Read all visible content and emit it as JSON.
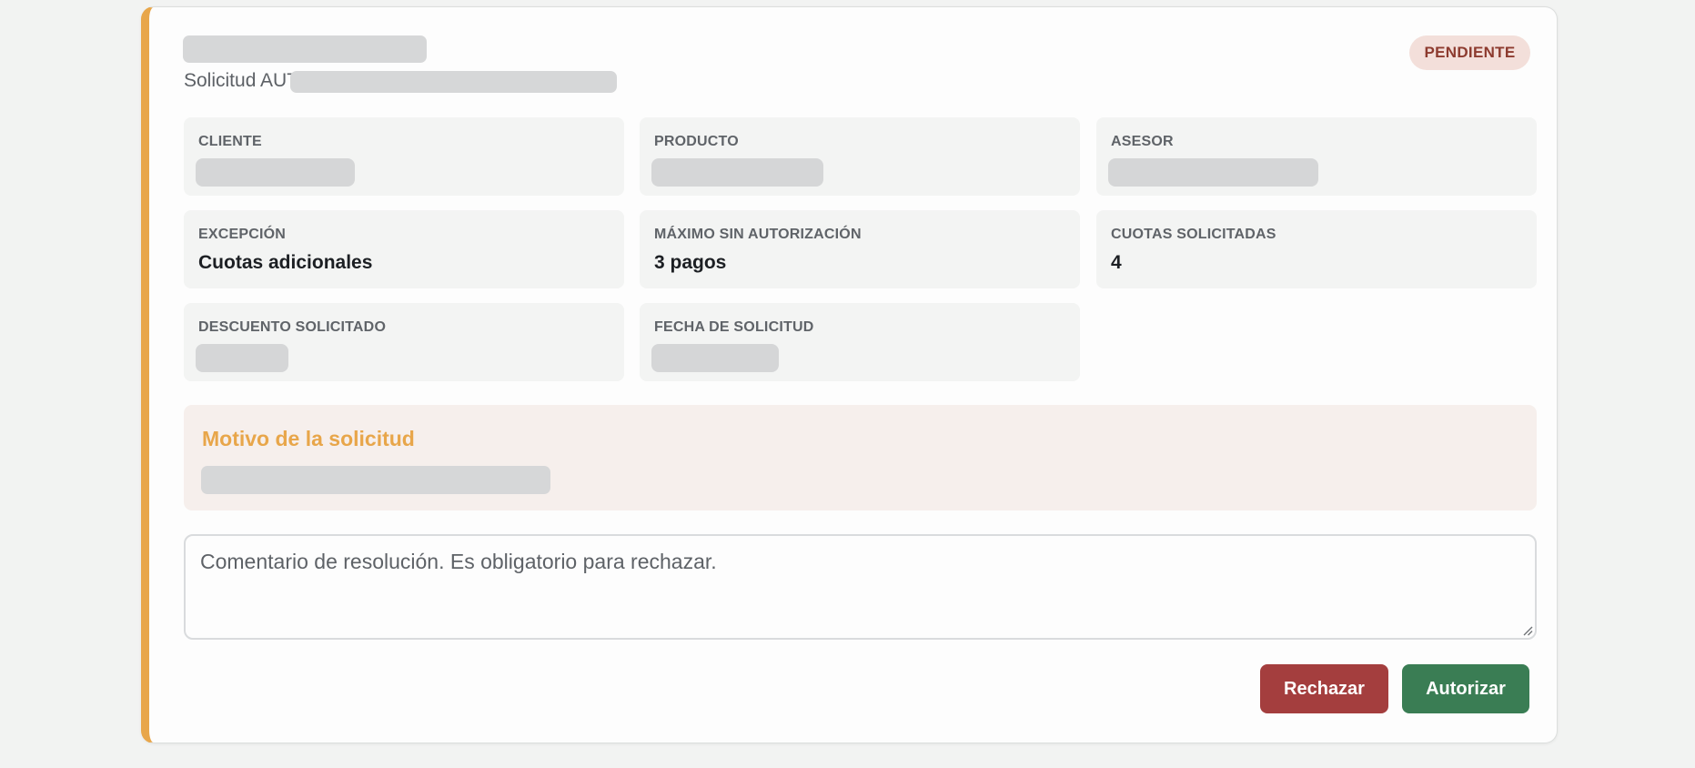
{
  "request": {
    "subtitle_prefix": "Solicitud AUT-",
    "status": "PENDIENTE"
  },
  "fields": [
    {
      "label": "CLIENTE",
      "value": ""
    },
    {
      "label": "PRODUCTO",
      "value": ""
    },
    {
      "label": "ASESOR",
      "value": ""
    },
    {
      "label": "EXCEPCIÓN",
      "value": "Cuotas adicionales"
    },
    {
      "label": "MÁXIMO SIN AUTORIZACIÓN",
      "value": "3 pagos"
    },
    {
      "label": "CUOTAS SOLICITADAS",
      "value": "4"
    },
    {
      "label": "DESCUENTO SOLICITADO",
      "value": ""
    },
    {
      "label": "FECHA DE SOLICITUD",
      "value": ""
    }
  ],
  "motivo": {
    "title": "Motivo de la solicitud"
  },
  "comment": {
    "placeholder": "Comentario de resolución. Es obligatorio para rechazar.",
    "value": ""
  },
  "actions": {
    "reject_label": "Rechazar",
    "authorize_label": "Autorizar"
  },
  "colors": {
    "accent": "#e8a64a",
    "status_bg": "#f3dfda",
    "status_text": "#8d3b2f",
    "reject": "#a43e3e",
    "authorize": "#3a7d54"
  }
}
